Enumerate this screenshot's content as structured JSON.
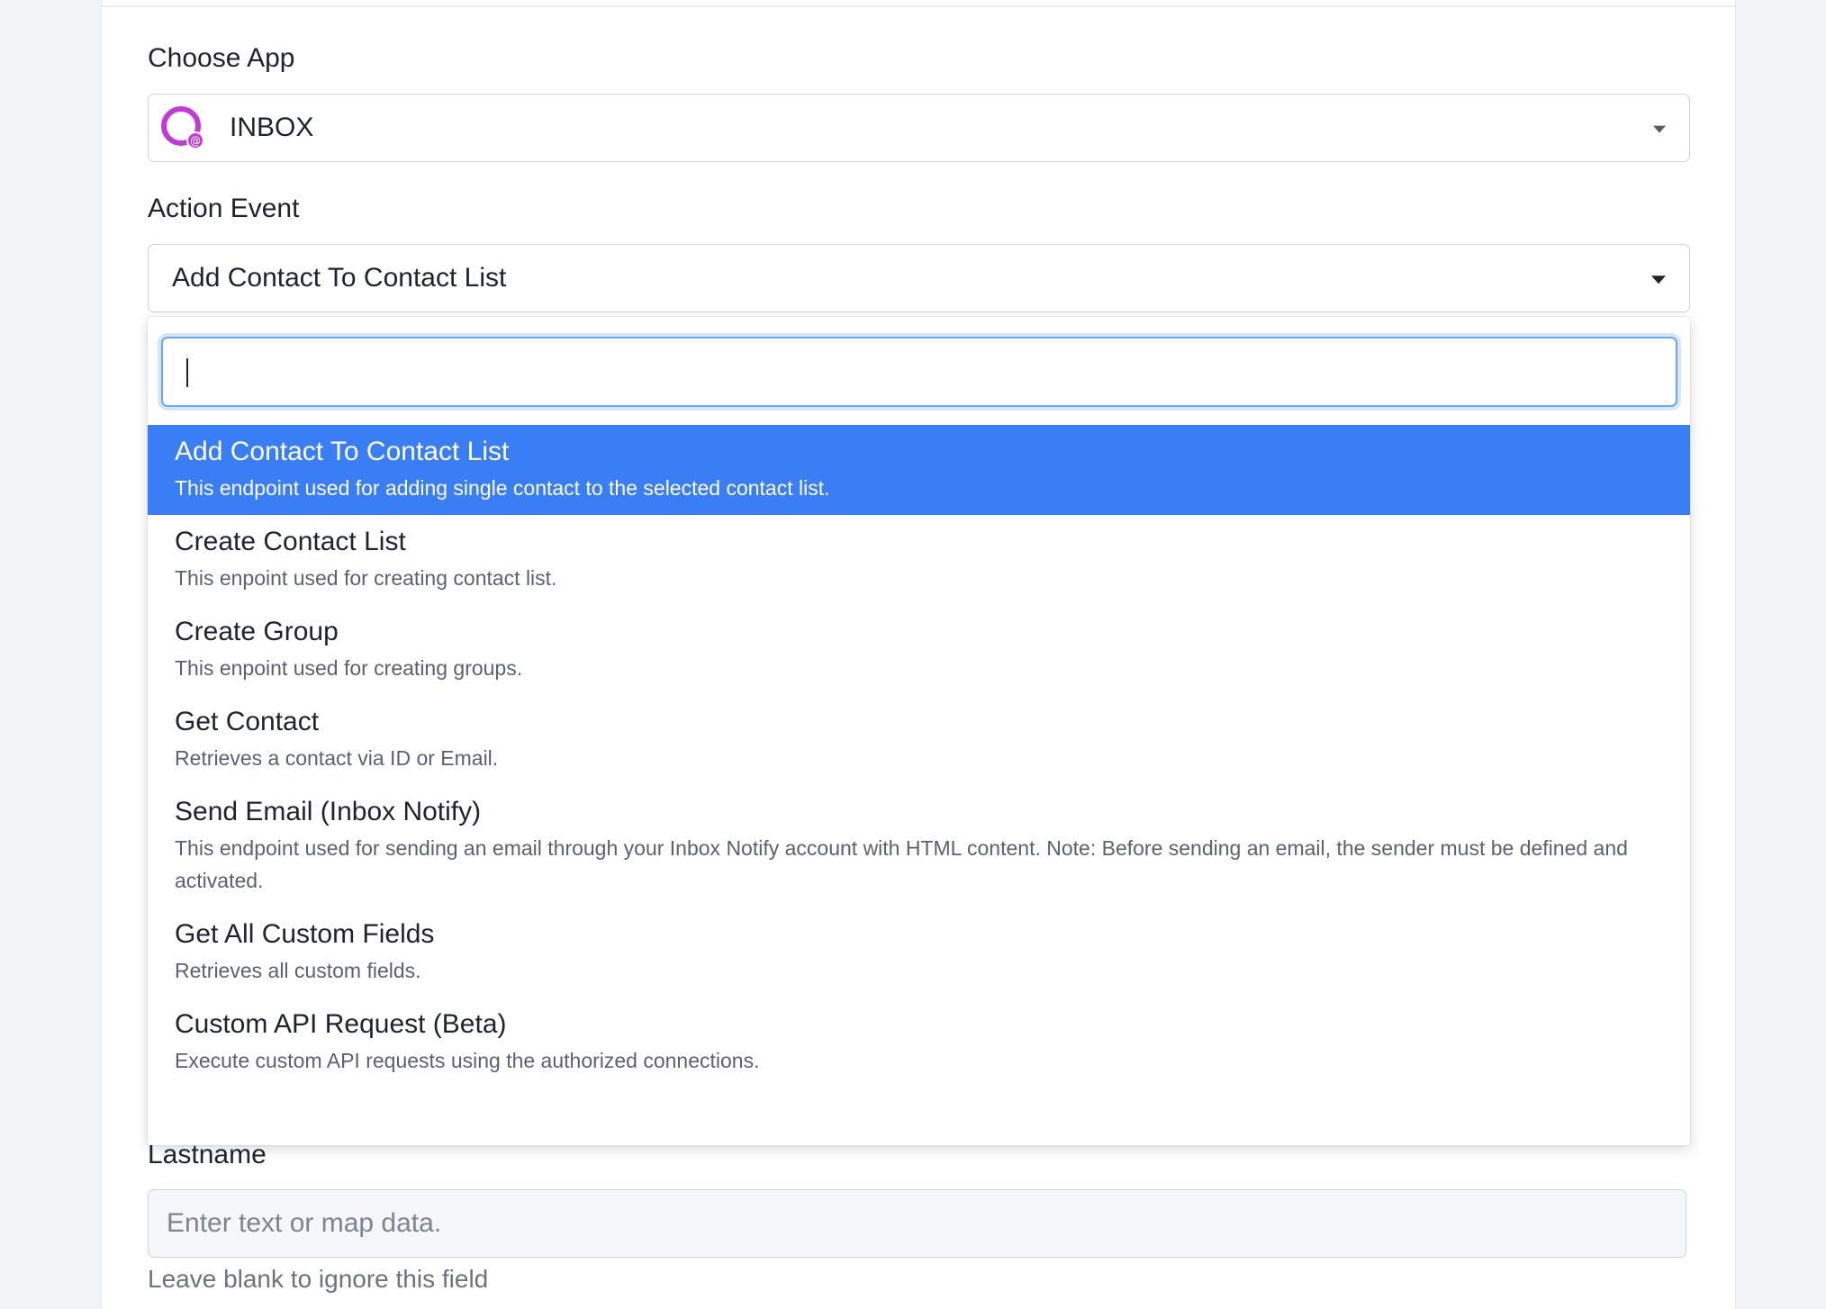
{
  "form": {
    "choose_app_label": "Choose App",
    "app_value": "INBOX",
    "action_event_label": "Action Event",
    "action_event_value": "Add Contact To Contact List",
    "lastname_label": "Lastname",
    "lastname_placeholder": "Enter text or map data.",
    "lastname_hint": "Leave blank to ignore this field"
  },
  "dropdown": {
    "search_value": "",
    "options": [
      {
        "title": "Add Contact To Contact List",
        "desc": "This endpoint used for adding single contact to the selected contact list.",
        "selected": true
      },
      {
        "title": "Create Contact List",
        "desc": "This enpoint used for creating contact list."
      },
      {
        "title": "Create Group",
        "desc": "This enpoint used for creating groups."
      },
      {
        "title": "Get Contact",
        "desc": "Retrieves a contact via ID or Email."
      },
      {
        "title": "Send Email (Inbox Notify)",
        "desc": "This endpoint used for sending an email through your Inbox Notify account with HTML content. Note: Before sending an email, the sender must be defined and activated."
      },
      {
        "title": "Get All Custom Fields",
        "desc": "Retrieves all custom fields."
      },
      {
        "title": "Custom API Request (Beta)",
        "desc": "Execute custom API requests using the authorized connections."
      }
    ]
  },
  "colors": {
    "accent": "#3a7ef5",
    "logo": "#c23ad6"
  },
  "icons": {
    "app_logo": "inbox-logo-icon",
    "caret": "caret-down-icon"
  }
}
